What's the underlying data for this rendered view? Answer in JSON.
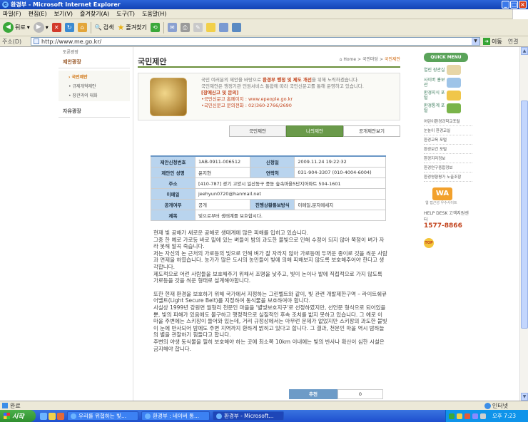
{
  "window": {
    "title": "환경부 - Microsoft Internet Explorer"
  },
  "menu": [
    "파일(F)",
    "편집(E)",
    "보기(V)",
    "즐겨찾기(A)",
    "도구(T)",
    "도움말(H)"
  ],
  "toolbar": {
    "back_label": "뒤로",
    "search_label": "검색",
    "favorites_label": "즐겨찾기"
  },
  "address": {
    "label": "주소(D)",
    "url": "http://www.me.go.kr/",
    "go_label": "이동",
    "links_label": "연결"
  },
  "leftnav": {
    "top_item": "토론광장",
    "section": "제안광장",
    "subitems": [
      "국민제안",
      "규제개혁제안",
      "장관과의 대화"
    ],
    "section2": "자유광장"
  },
  "page": {
    "title": "국민제안",
    "breadcrumb": {
      "home": "Home",
      "sep": ">",
      "parent": "국민마당",
      "current": "국민제안"
    }
  },
  "notice": {
    "line1_pre": "국민 여러분의 제안을 바탕으로 ",
    "line1_hl": "환경부 행정 및 제도 개선",
    "line1_post": "을 위해 노력하겠습니다.",
    "line2": "국민제안은 행정기관 민원서비스 통합에 따라 국민신문고를 통해 운영하고 있습니다.",
    "line3": "[장애신고 및 문의]",
    "line4": "•국민신문고 홈페이지 : www.epeople.go.kr",
    "line5": "•국민신문고 문의전화 : 02)360-2766/2690"
  },
  "tabs": [
    "국민제안",
    "나의제안",
    "공개제안보기"
  ],
  "table": {
    "rows": [
      {
        "k1": "제안신청번호",
        "v1": "1AB-0911-006512",
        "k2": "신청일",
        "v2": "2009.11.24 19:22:32"
      },
      {
        "k1": "제안인 성명",
        "v1": "윤지현",
        "k2": "연락처",
        "v2": "031-904-3307 (010-4004-6004)"
      }
    ],
    "address_label": "주소",
    "address_value": "[410-787] 경기 고양시 일산동구 풍동 숲속마을5단지아파트 504-1601",
    "email_label": "이메일",
    "email_value": "jeehyun0720@hanmail.net",
    "public_label": "공개여부",
    "public_value": "공개",
    "notify_label": "진행상황통보방식",
    "notify_value": "이메일,문자메세지",
    "subject_label": "제목",
    "subject_value": "빛으로부터 생태계를 보호합시다."
  },
  "body": [
    "현재 빛 공해가 새로운 공해로 생태계에 많은 피해를 입히고 있습니다.\n그중 한 예로 가로등 바로 밑에 있는 벼들이 밤의 과도한 불빛으로 인해 수정이 되지 않아 쭉정이 벼가 자라 못해 알곡 죽습니다.\n저는 자신의 논 근처의 가로등의 빛으로 인해 벼가 잘 자라지 않아 가로등에 두꺼운 종이로 갓을 씌운 사람과 면제을 하였습니다. 농가가 많은 도시의 농민들이 빛에 의해 피해보지 않도록 보호해주어야 한다고 생각합니다.\n제도적으로 어런 사람들을 보호해주기 위해서 조명을 낮추고, 빛이 논이나 밭에 직접적으로 가지 않도록 가로등을 갓을 씌운 형태로 설계해야합니다.",
    "또한 현재 환경을 보호하기 위해 국가에서 지정하는 그린벨트와 같이, 빛 관련 개발제한구역 – 라이트쉐큐어벨트(Light Secure Belt)를 지정하여 동식물을 보호하여야 합니다.\n사실상 1999년 강원면 월형리 천문인 마을을 '별빛보호지구'로 선정하였지만, 선언문 형식으로 되어있을 뿐, 빛의 피해가 있음에도 불구하고 행정적으로 실질적인 후속 조치를 밟지 못하고 있습니다. 그 예로 이 마을 주변에는 스키장이 들어와 있는데, 거리 규정상에서는 아무런 문제가 없었지만 스키장의 과도한 불빛이 눈에 반사되어 밤에도 주변 지역까지 환하게 밝히고 있다고 합니다. 그 결과, 천문인 마을 역시 밤하늘의 별을 관찰하기 힘들다고 합니다.\n주변의 야생 동식물을 필히 보호해야 하는 곳에 최소쪽 10km 이내에는 빛의 반사나 확산이 심한 시설은 금지해야 합니다."
  ],
  "recommend": {
    "label": "추천",
    "value": "0"
  },
  "quickmenu": {
    "title": "QUICK MENU",
    "items": [
      "열린 장관실",
      "사이버 홍보관",
      "환경지식 포털",
      "환경통계 포털"
    ],
    "list": [
      "어린이환경과학교포털",
      "눈높이 환경교실",
      "환경교육 포털",
      "환경보건 포털",
      "환경지리정보",
      "환경연구종합정보",
      "환경영향평가 노출조항"
    ],
    "wa_label": "WA",
    "wa_sub": "웹 접근성 우수사이트",
    "helpdesk": "HELP DESK 고객지원센터",
    "phone": "1577-8866",
    "top": "TOP"
  },
  "status": {
    "text": "완료",
    "zone": "인터넷"
  },
  "taskbar": {
    "start": "시작",
    "tasks": [
      "우리를 위협하는 빛...",
      "환경부 : 네이버 통...",
      "환경부 - Microsoft..."
    ],
    "clock": "오후 7:23"
  }
}
